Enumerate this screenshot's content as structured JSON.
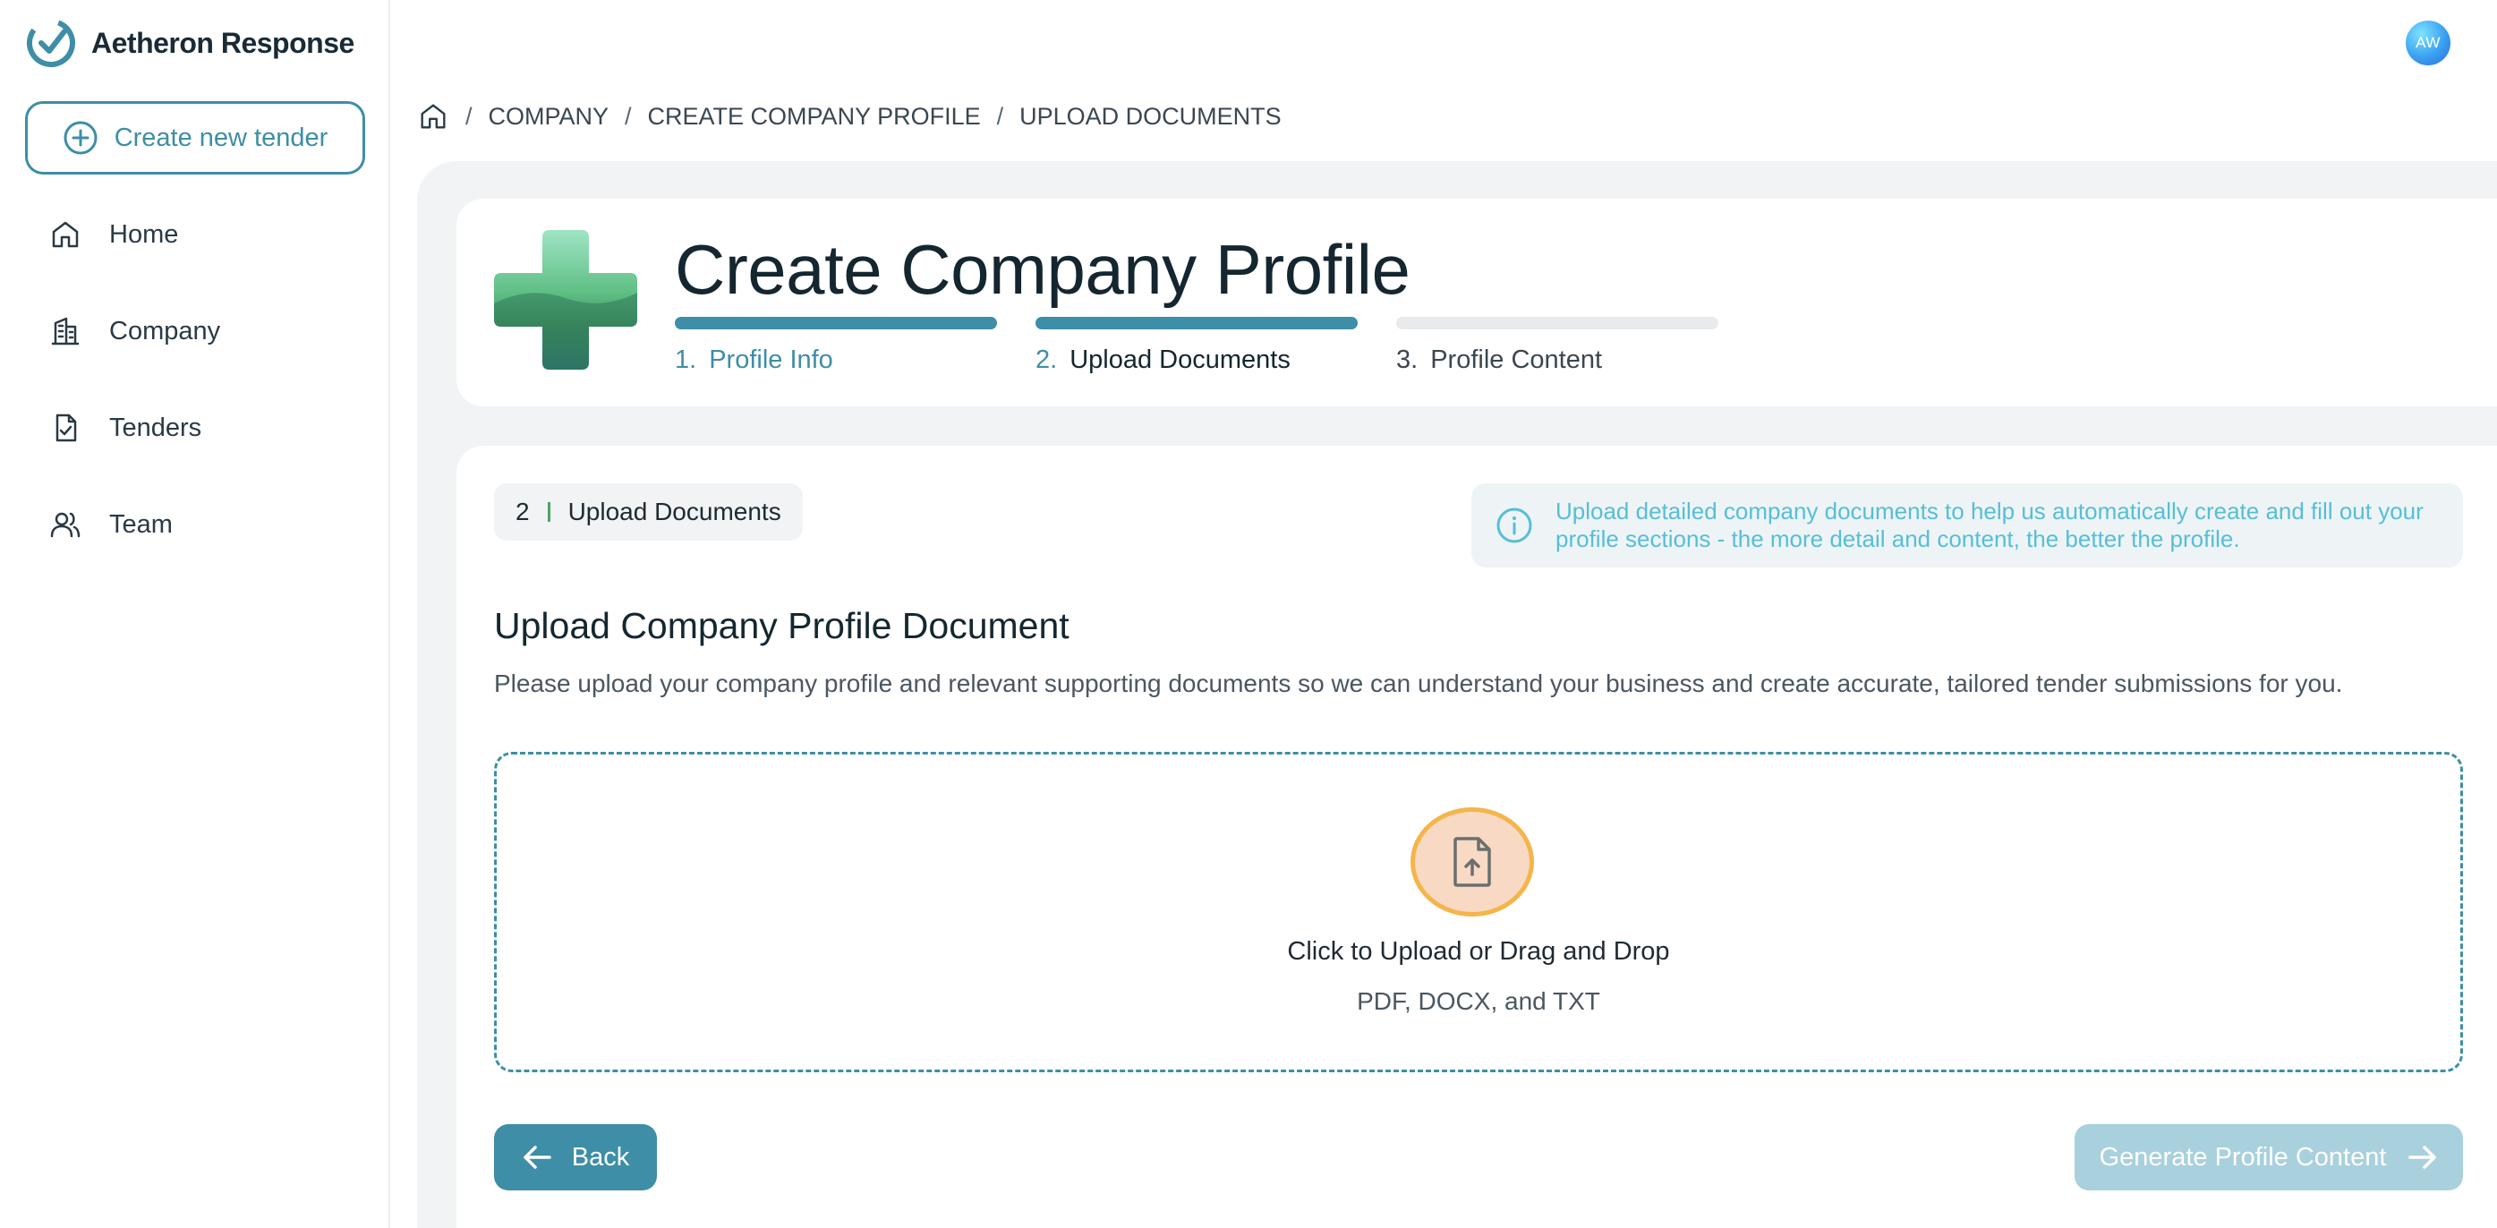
{
  "app": {
    "name": "Aetheron Response",
    "logo_icon": "check-circle-icon"
  },
  "sidebar": {
    "create_button": "Create new tender",
    "items": [
      {
        "label": "Home",
        "icon": "home-icon"
      },
      {
        "label": "Company",
        "icon": "building-icon"
      },
      {
        "label": "Tenders",
        "icon": "document-check-icon"
      },
      {
        "label": "Team",
        "icon": "users-icon"
      }
    ]
  },
  "user": {
    "initials": "AW"
  },
  "breadcrumb": {
    "items": [
      "COMPANY",
      "CREATE COMPANY PROFILE",
      "UPLOAD DOCUMENTS"
    ]
  },
  "header": {
    "title": "Create Company Profile",
    "steps": [
      {
        "num": "1.",
        "label": "Profile Info",
        "state": "completed"
      },
      {
        "num": "2.",
        "label": "Upload Documents",
        "state": "current"
      },
      {
        "num": "3.",
        "label": "Profile Content",
        "state": "upcoming"
      }
    ]
  },
  "content": {
    "step_chip": {
      "number": "2",
      "label": "Upload Documents"
    },
    "info": "Upload detailed company documents to help us automatically create and fill out your profile sections - the more detail and content, the better the profile.",
    "section_title": "Upload Company Profile Document",
    "section_desc": "Please upload your company profile and relevant supporting documents so we can understand your business and create accurate, tailored tender submissions for you.",
    "dropzone": {
      "title": "Click to Upload or Drag and Drop",
      "formats": "PDF, DOCX, and TXT"
    },
    "back_label": "Back",
    "generate_label": "Generate Profile Content"
  },
  "colors": {
    "accent": "#3d8ea6",
    "accent_disabled": "#a9d0dd",
    "info_text": "#56bed8",
    "upload_ring": "#f4b54a",
    "upload_fill": "#f8d9c4"
  }
}
